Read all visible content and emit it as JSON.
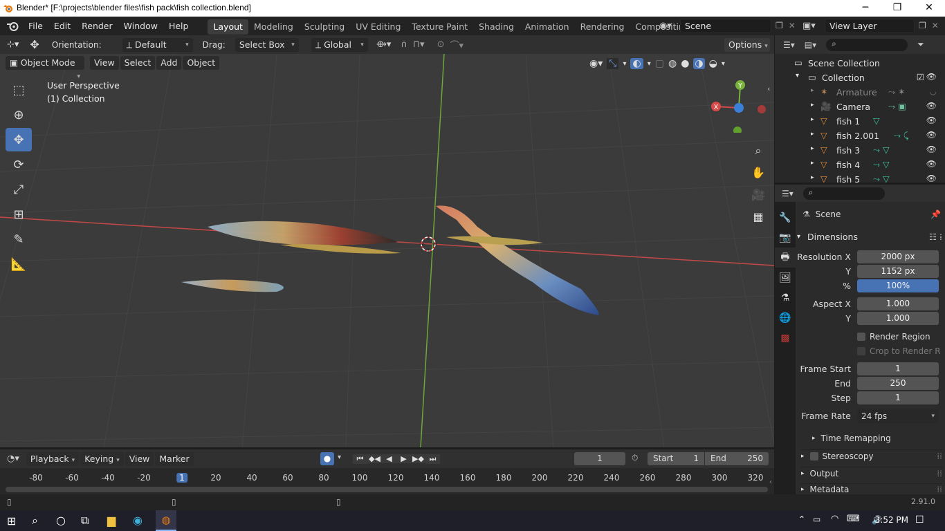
{
  "window": {
    "title": "Blender* [F:\\projects\\blender files\\fish pack\\fish collection.blend]",
    "minimize": "─",
    "maximize": "❐",
    "close": "✕"
  },
  "topbar": {
    "menus": [
      "File",
      "Edit",
      "Render",
      "Window",
      "Help"
    ],
    "workspaces": [
      "Layout",
      "Modeling",
      "Sculpting",
      "UV Editing",
      "Texture Paint",
      "Shading",
      "Animation",
      "Rendering",
      "Compositing",
      "S"
    ],
    "active_workspace": "Layout",
    "scene": "Scene",
    "view_layer": "View Layer"
  },
  "tool_header": {
    "orientation_label": "Orientation:",
    "orientation_value": "Default",
    "drag_label": "Drag:",
    "drag_value": "Select Box",
    "transform_space": "Global",
    "options": "Options"
  },
  "viewport_header": {
    "mode": "Object Mode",
    "menus": [
      "View",
      "Select",
      "Add",
      "Object"
    ]
  },
  "viewport": {
    "perspective": "User Perspective",
    "collection": "(1) Collection",
    "gizmo_x": "X",
    "gizmo_y": "Y"
  },
  "outliner": {
    "root": "Scene Collection",
    "collection": "Collection",
    "items": [
      "Armature",
      "Camera",
      "fish 1",
      "fish 2.001",
      "fish 3",
      "fish 4",
      "fish 5"
    ]
  },
  "properties": {
    "context": "Scene",
    "panel": "Dimensions",
    "resolution_x_label": "Resolution X",
    "resolution_x": "2000 px",
    "resolution_y_label": "Y",
    "resolution_y": "1152 px",
    "percent_label": "%",
    "percent": "100%",
    "aspect_x_label": "Aspect X",
    "aspect_x": "1.000",
    "aspect_y_label": "Y",
    "aspect_y": "1.000",
    "render_region": "Render Region",
    "crop": "Crop to Render R...",
    "frame_start_label": "Frame Start",
    "frame_start": "1",
    "end_label": "End",
    "end": "250",
    "step_label": "Step",
    "step": "1",
    "frame_rate_label": "Frame Rate",
    "frame_rate": "24 fps",
    "time_remapping": "Time Remapping",
    "stereoscopy": "Stereoscopy",
    "output": "Output",
    "metadata": "Metadata"
  },
  "timeline": {
    "menus": [
      "Playback",
      "Keying",
      "View",
      "Marker"
    ],
    "current_frame": "1",
    "start_label": "Start",
    "start": "1",
    "end_label": "End",
    "end": "250",
    "ticks": [
      "-80",
      "-60",
      "-40",
      "-20",
      "1",
      "20",
      "40",
      "60",
      "80",
      "100",
      "120",
      "140",
      "160",
      "180",
      "200",
      "220",
      "240",
      "260",
      "280",
      "300",
      "320"
    ]
  },
  "status": {
    "version": "2.91.0"
  },
  "taskbar": {
    "time": "3:52 PM"
  },
  "colors": {
    "accent": "#4772b3",
    "axis_x": "#d84a4a",
    "axis_y": "#7ab33c",
    "gizmo_z": "#3c7fd8"
  }
}
